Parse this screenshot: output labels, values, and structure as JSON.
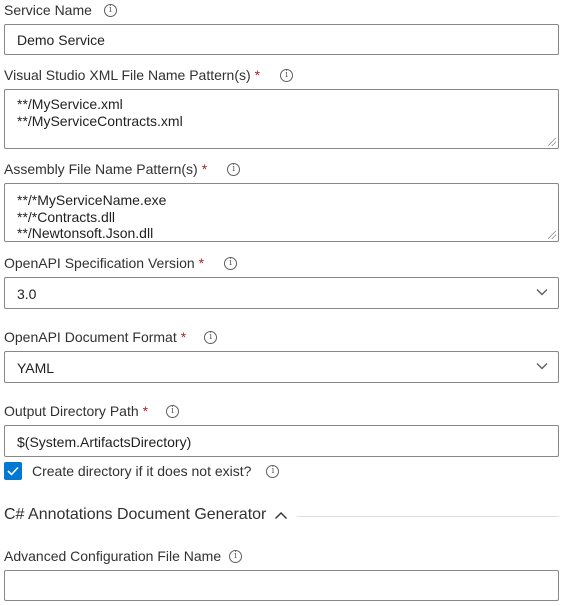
{
  "service_name": {
    "label": "Service Name",
    "value": "Demo Service"
  },
  "xml_pattern": {
    "label": "Visual Studio XML File Name Pattern(s)",
    "lines": [
      "**/MyService.xml",
      "**/MyServiceContracts.xml"
    ]
  },
  "assembly_pattern": {
    "label": "Assembly File Name Pattern(s)",
    "lines": [
      "**/*MyServiceName.exe",
      "**/*Contracts.dll",
      "**/Newtonsoft.Json.dll"
    ]
  },
  "openapi_version": {
    "label": "OpenAPI Specification Version",
    "value": "3.0"
  },
  "doc_format": {
    "label": "OpenAPI Document Format",
    "value": "YAML"
  },
  "output_dir": {
    "label": "Output Directory Path",
    "value": "$(System.ArtifactsDirectory)"
  },
  "create_dir": {
    "label": "Create directory if it does not exist?",
    "checked": true
  },
  "section": {
    "title": "C# Annotations Document Generator"
  },
  "advanced_config": {
    "label": "Advanced Configuration File Name",
    "value": ""
  },
  "required_marker": "*",
  "info_glyph": "i",
  "colors": {
    "accent": "#0078d4",
    "required": "#a4262c",
    "border": "#8a8886"
  }
}
